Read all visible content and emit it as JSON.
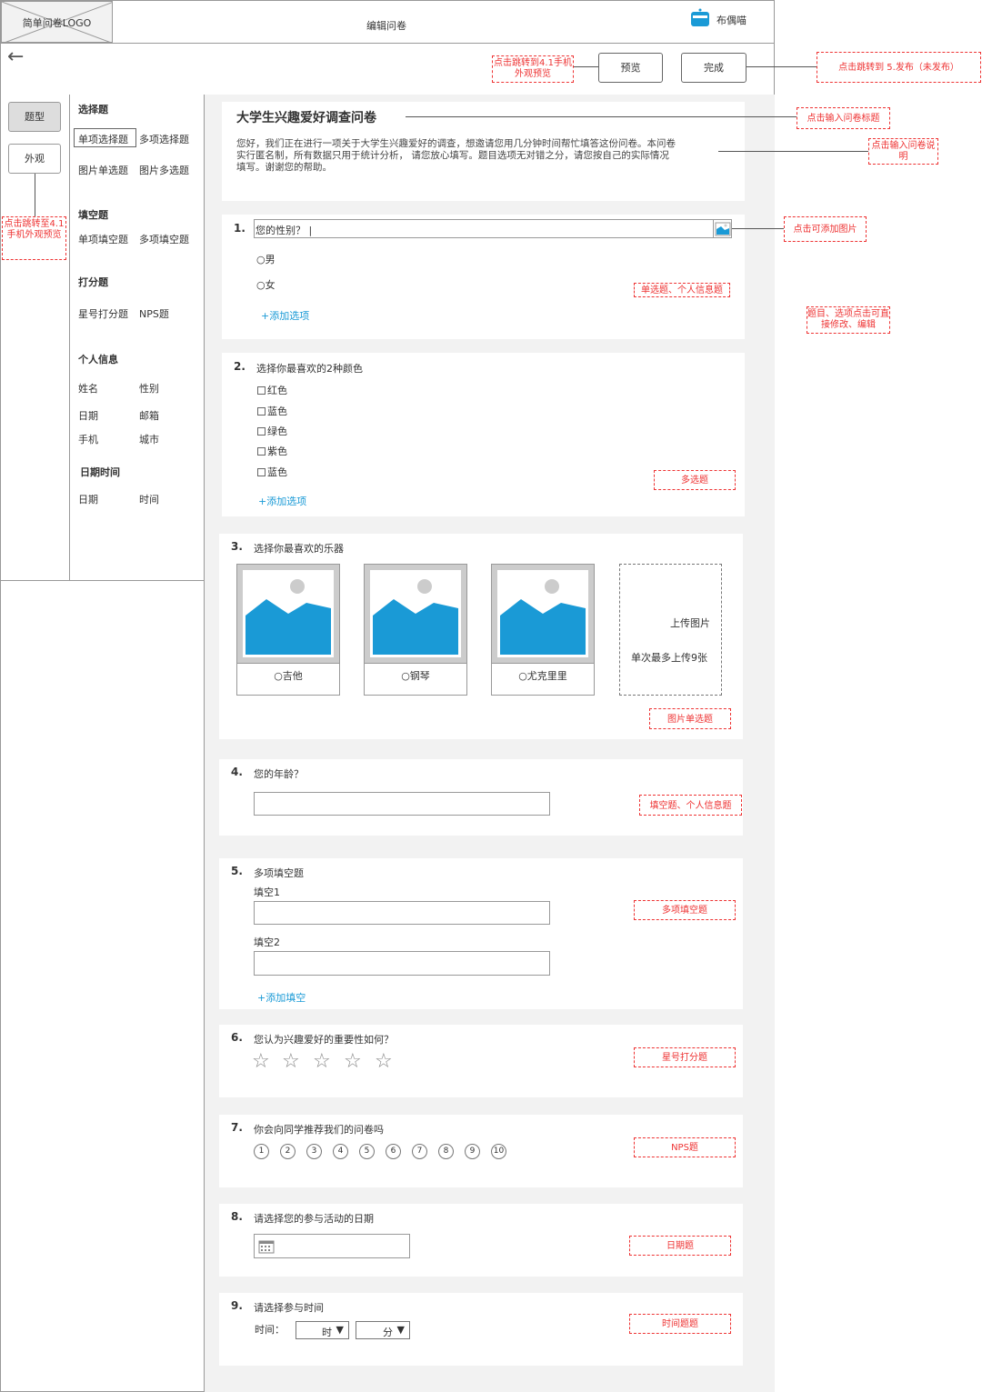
{
  "header": {
    "logo": "简单问卷LOGO",
    "title": "编辑问卷",
    "user": "布偶喵"
  },
  "toolbar": {
    "preview_label": "预览",
    "done_label": "完成"
  },
  "left_tabs": {
    "type_label": "题型",
    "look_label": "外观"
  },
  "question_types": {
    "choice_title": "选择题",
    "single_choice": "单项选择题",
    "multi_choice": "多项选择题",
    "image_single": "图片单选题",
    "image_multi": "图片多选题",
    "fill_title": "填空题",
    "single_fill": "单项填空题",
    "multi_fill": "多项填空题",
    "rating_title": "打分题",
    "star_rating": "星号打分题",
    "nps": "NPS题",
    "personal_title": "个人信息",
    "name": "姓名",
    "gender": "性别",
    "date": "日期",
    "email": "邮箱",
    "phone": "手机",
    "city": "城市",
    "datetime_title": "日期时间",
    "dt_date": "日期",
    "dt_time": "时间"
  },
  "survey": {
    "title": "大学生兴趣爱好调查问卷",
    "description_line1": "您好，我们正在进行一项关于大学生兴趣爱好的调查，想邀请您用几分钟时间帮忙填答这份问卷。本问卷",
    "description_line2": "实行匿名制，所有数据只用于统计分析，  请您放心填写。题目选项无对错之分，请您按自己的实际情况",
    "description_line3": "填写。谢谢您的帮助。"
  },
  "questions": {
    "q1": {
      "num": "1.",
      "text": "您的性别？ |",
      "options": [
        "○男",
        "○女"
      ],
      "add": "+添加选项"
    },
    "q2": {
      "num": "2.",
      "text": "选择你最喜欢的2种颜色",
      "options": [
        "红色",
        "蓝色",
        "绿色",
        "紫色",
        "蓝色"
      ],
      "add": "+添加选项"
    },
    "q3": {
      "num": "3.",
      "text": "选择你最喜欢的乐器",
      "options": [
        "○吉他",
        "○钢琴",
        "○尤克里里"
      ],
      "upload": "上传图片",
      "upload_limit": "单次最多上传9张"
    },
    "q4": {
      "num": "4.",
      "text": "您的年龄？"
    },
    "q5": {
      "num": "5.",
      "text": "多项填空题",
      "blank1": "填空1",
      "blank2": "填空2",
      "add": "+添加填空"
    },
    "q6": {
      "num": "6.",
      "text": "您认为兴趣爱好的重要性如何？",
      "stars": 5
    },
    "q7": {
      "num": "7.",
      "text": "你会向同学推荐我们的问卷吗",
      "scale": [
        "1",
        "2",
        "3",
        "4",
        "5",
        "6",
        "7",
        "8",
        "9",
        "10"
      ]
    },
    "q8": {
      "num": "8.",
      "text": "请选择您的参与活动的日期"
    },
    "q9": {
      "num": "9.",
      "text": "请选择参与时间",
      "time_label": "时间：",
      "hour": "时",
      "minute": "分"
    }
  },
  "notes": {
    "preview_jump": "点击跳转到4.1手机外观预览",
    "done_jump": "点击跳转到  5.发布（未发布）",
    "title_input": "点击输入问卷标题",
    "desc_input": "点击输入问卷说明",
    "add_image": "点击可添加图片",
    "edit_hint": "题目、选项点击可直接修改、编辑",
    "look_jump": "点击跳转至4.1手机外观预览",
    "q1_tag": "单选题、个人信息题",
    "q2_tag": "多选题",
    "q3_tag": "图片单选题",
    "q4_tag": "填空题、个人信息题",
    "q5_tag": "多项填空题",
    "q6_tag": "星号打分题",
    "q7_tag": "NPS题",
    "q8_tag": "日期题",
    "q9_tag": "时间题题"
  },
  "colors": {
    "accent": "#1a9ad6",
    "annotation": "#e33333",
    "canvas_bg": "#f2f2f2"
  }
}
